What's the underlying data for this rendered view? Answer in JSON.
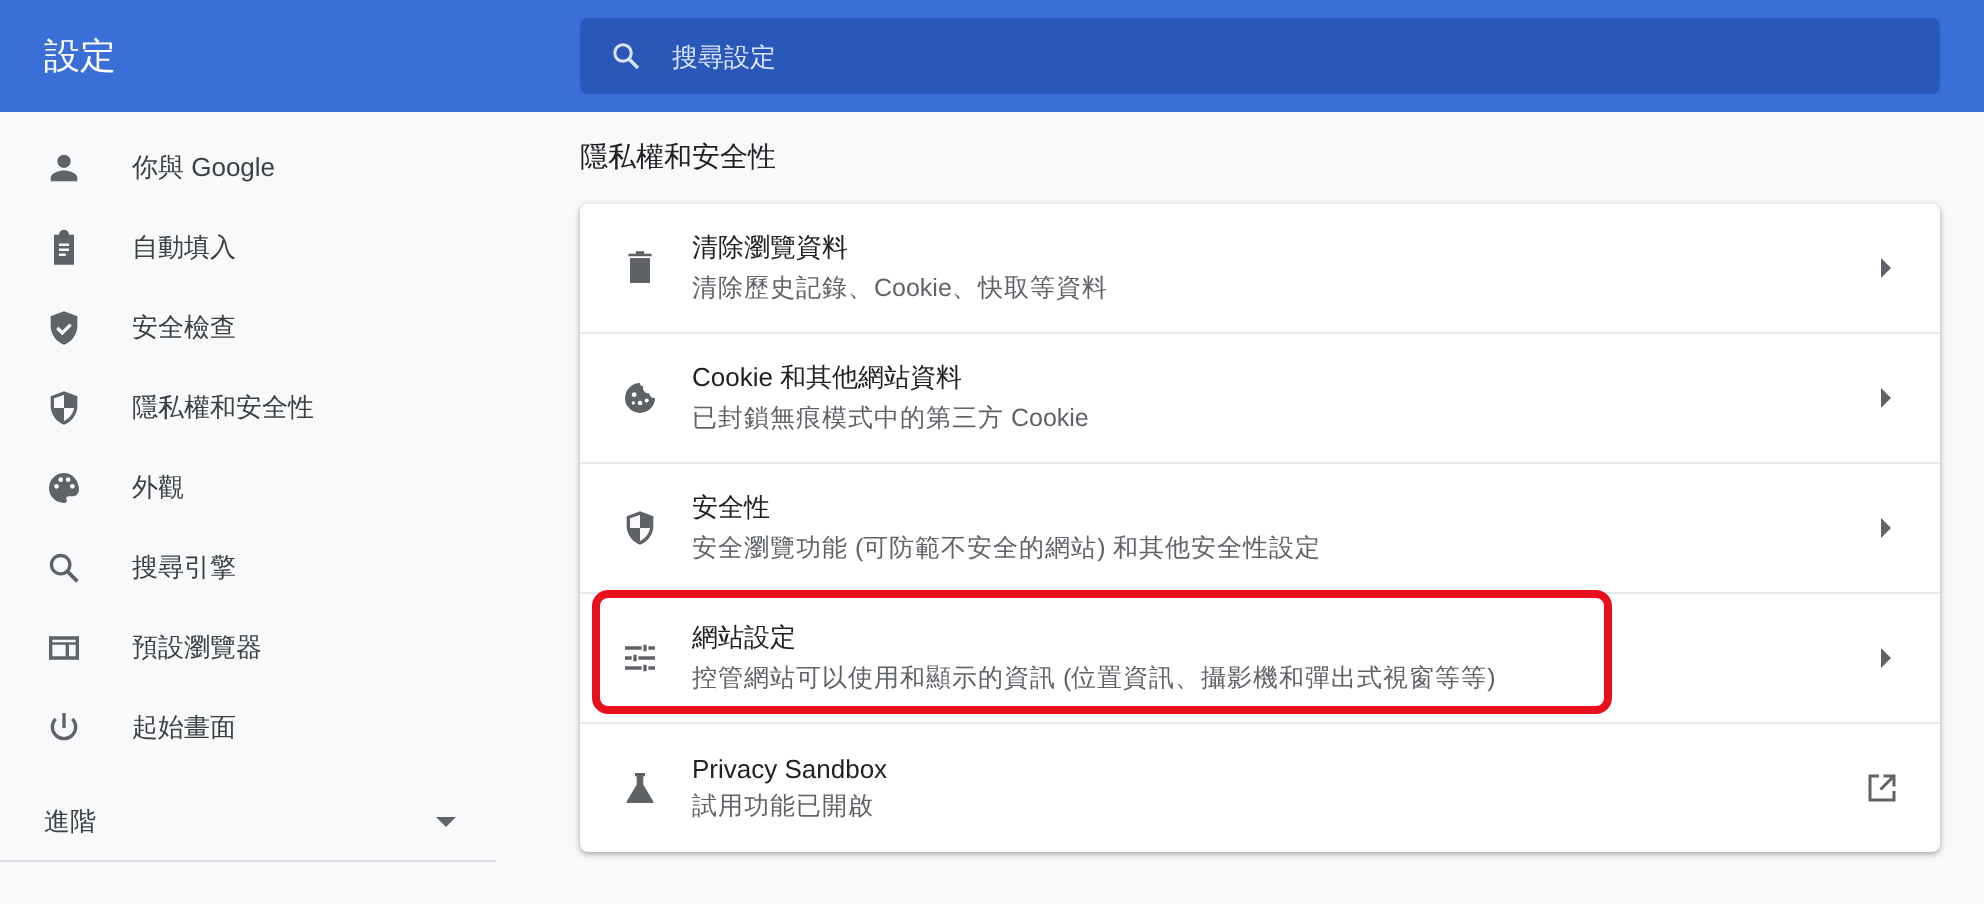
{
  "header": {
    "title": "設定",
    "search": {
      "placeholder": "搜尋設定"
    }
  },
  "sidebar": {
    "items": [
      {
        "label": "你與 Google"
      },
      {
        "label": "自動填入"
      },
      {
        "label": "安全檢查"
      },
      {
        "label": "隱私權和安全性"
      },
      {
        "label": "外觀"
      },
      {
        "label": "搜尋引擎"
      },
      {
        "label": "預設瀏覽器"
      },
      {
        "label": "起始畫面"
      }
    ],
    "advanced": {
      "label": "進階",
      "expanded": false
    }
  },
  "section": {
    "title": "隱私權和安全性",
    "rows": [
      {
        "title": "清除瀏覽資料",
        "subtitle": "清除歷史記錄、Cookie、快取等資料",
        "kind": "submenu",
        "highlighted": false
      },
      {
        "title": "Cookie 和其他網站資料",
        "subtitle": "已封鎖無痕模式中的第三方 Cookie",
        "kind": "submenu",
        "highlighted": false
      },
      {
        "title": "安全性",
        "subtitle": "安全瀏覽功能 (可防範不安全的網站) 和其他安全性設定",
        "kind": "submenu",
        "highlighted": false
      },
      {
        "title": "網站設定",
        "subtitle": "控管網站可以使用和顯示的資訊 (位置資訊、攝影機和彈出式視窗等等)",
        "kind": "submenu",
        "highlighted": true
      },
      {
        "title": "Privacy Sandbox",
        "subtitle": "試用功能已開啟",
        "kind": "external",
        "highlighted": false
      }
    ]
  }
}
